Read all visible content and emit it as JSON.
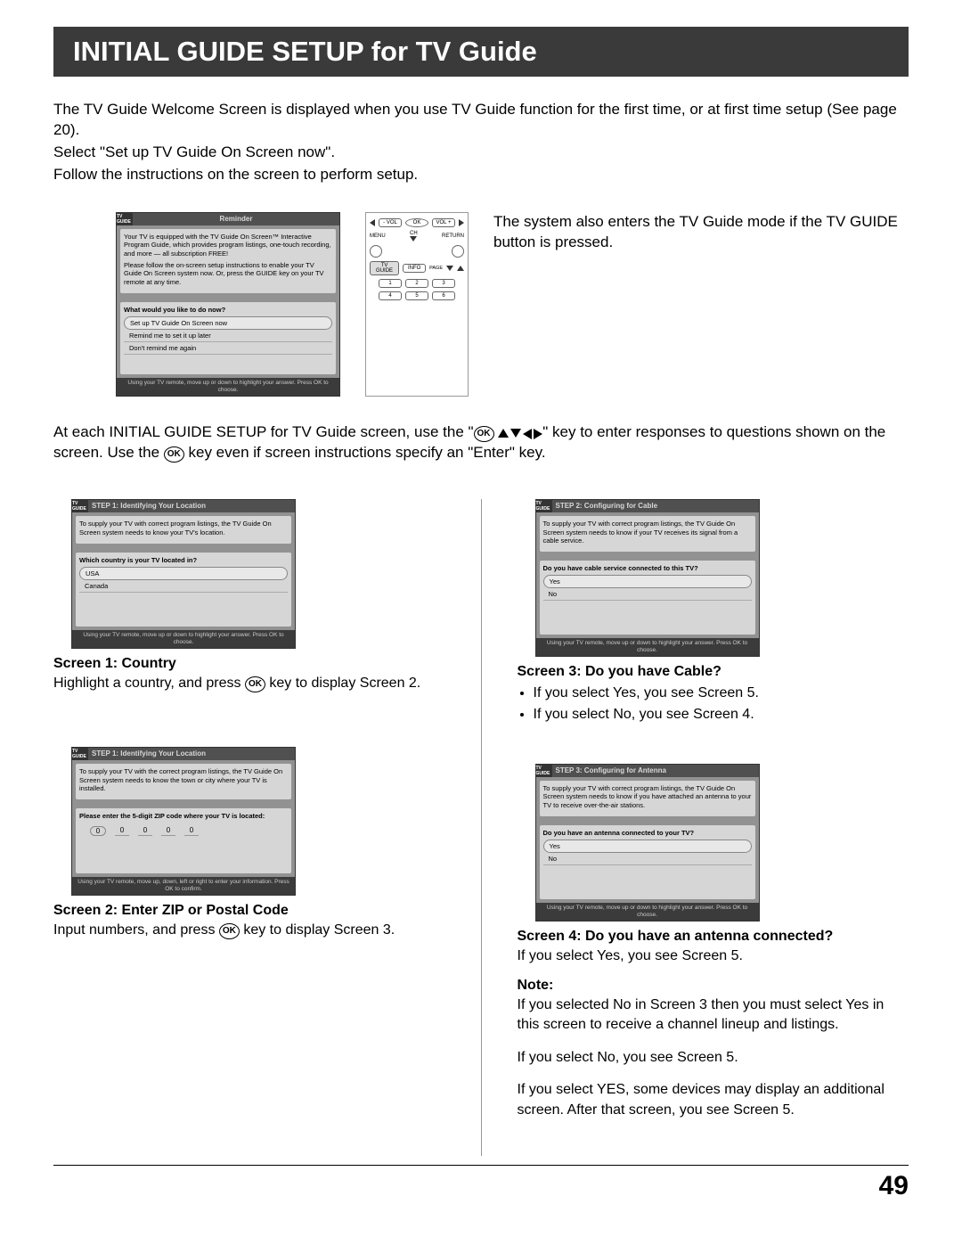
{
  "title": "INITIAL GUIDE SETUP for TV Guide",
  "intro": {
    "p1": "The TV Guide Welcome Screen is displayed when you use TV Guide function for the first time, or at first time setup (See page 20).",
    "p2": "Select \"Set up TV Guide On Screen now\".",
    "p3": "Follow the instructions on the screen to perform setup."
  },
  "welcome_box": {
    "logo": "TV GUIDE",
    "header": "Reminder",
    "msg1": "Your TV is equipped with the TV Guide On Screen™ Interactive Program Guide, which provides program listings, one-touch recording, and more — all subscription FREE!",
    "msg2": "Please follow the on-screen setup instructions to enable your TV Guide On Screen system now. Or, press the GUIDE key on your TV remote at any time.",
    "question": "What would you like to do now?",
    "opts": [
      "Set up TV Guide On Screen now",
      "Remind me to set it up later",
      "Don't remind me again"
    ],
    "footer": "Using your TV remote, move up or down to highlight your answer.  Press OK to choose."
  },
  "remote": {
    "volm": "- VOL",
    "ok": "OK",
    "volp": "VOL +",
    "menu": "MENU",
    "ch": "CH",
    "return": "RETURN",
    "tvguide": "TV GUIDE",
    "info": "INFO",
    "page": "PAGE",
    "nums": [
      "1",
      "2",
      "3",
      "4",
      "5",
      "6"
    ]
  },
  "side_text": "The system also enters the TV Guide mode if the TV GUIDE button is pressed.",
  "mid": {
    "pre": "At each INITIAL GUIDE SETUP for TV Guide screen, use the \"",
    "post": "\" key to enter responses to questions shown on the screen. Use the ",
    "tail": " key even if screen instructions specify an \"Enter\" key.",
    "ok": "OK"
  },
  "screen1": {
    "box": {
      "logo": "TV GUIDE",
      "header": "STEP 1: Identifying Your Location",
      "msg": "To supply your TV with correct program listings, the TV Guide On Screen system needs to know your TV's location.",
      "question": "Which country is your TV located in?",
      "opts": [
        "USA",
        "Canada"
      ],
      "footer": "Using your TV remote, move up or down to highlight your answer.  Press OK to choose."
    },
    "title": "Screen 1:   Country",
    "text_pre": "Highlight a country, and press ",
    "text_post": " key to display Screen 2."
  },
  "screen2": {
    "box": {
      "logo": "TV GUIDE",
      "header": "STEP 1: Identifying Your Location",
      "msg": "To supply your TV with the correct program listings, the TV Guide On Screen system needs to know the town or city where your TV is installed.",
      "question": "Please enter the 5-digit ZIP code where your TV is located:",
      "footer": "Using your TV remote, move up, down, left or right to enter your information. Press OK to confirm."
    },
    "title": "Screen 2:   Enter ZIP or Postal Code",
    "text_pre": "Input numbers, and press ",
    "text_post": " key to display Screen 3."
  },
  "screen3": {
    "box": {
      "logo": "TV GUIDE",
      "header": "STEP 2: Configuring for Cable",
      "msg": "To supply your TV with correct program listings, the TV Guide On Screen system needs to know if your TV receives its signal from a cable service.",
      "question": "Do you have cable service connected to this TV?",
      "opts": [
        "Yes",
        "No"
      ],
      "footer": "Using your TV remote, move up or down to highlight your answer.  Press OK to choose."
    },
    "title": "Screen 3:   Do you have Cable?",
    "bullets": [
      "If you select Yes, you see Screen 5.",
      "If you select No, you see Screen 4."
    ]
  },
  "screen4": {
    "box": {
      "logo": "TV GUIDE",
      "header": "STEP 3: Configuring for Antenna",
      "msg": "To supply your TV with correct program listings, the TV Guide On Screen system needs to know if you have attached an antenna to your TV to receive over-the-air stations.",
      "question": "Do you have an antenna connected to your TV?",
      "opts": [
        "Yes",
        "No"
      ],
      "footer": "Using your TV remote, move up or down to highlight your answer.  Press OK to choose."
    },
    "title": "Screen 4:   Do you have an antenna connected?",
    "text": "If you select Yes, you see Screen 5.",
    "note_h": "Note:",
    "note1": "If you selected No in Screen 3 then you must select Yes in this screen to receive a channel lineup and listings.",
    "note2": "If you select No, you see Screen 5.",
    "note3": "If you select YES, some devices may display an additional screen. After that screen, you see Screen 5."
  },
  "digit": "0",
  "page_number": "49"
}
